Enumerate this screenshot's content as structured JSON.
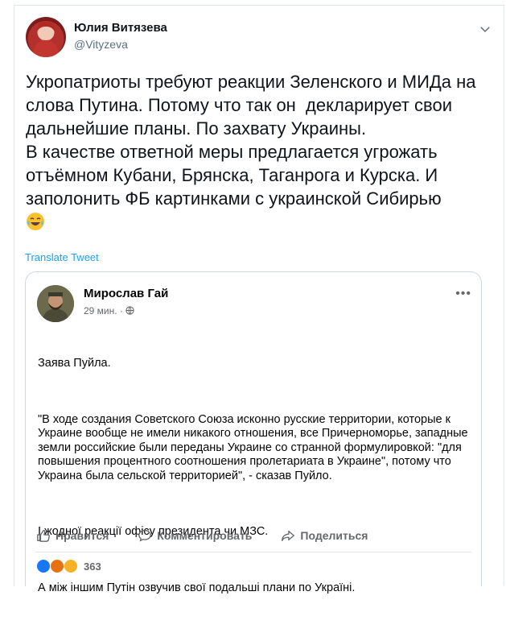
{
  "tweet": {
    "author_name": "Юлия Витязева",
    "author_handle": "@Vityzeva",
    "body": "Укропатриоты требуют реакции Зеленского и МИДа на слова Путина. Потому что так он  декларирует свои дальнейшие планы. По захвату Украины.\nВ качестве ответной меры предлагается угрожать отъёмном Кубани, Брянска, Таганрога и Курска. И заполонить ФБ картинками с украинской Сибирью",
    "translate_label": "Translate Tweet",
    "more_icon": "chevron-down-icon",
    "emoji": "😂"
  },
  "facebook_post": {
    "author_name": "Мирослав Гай",
    "time": "29 мин.",
    "paragraphs": [
      "Заява Пуйла.",
      "\"В ходе создания Советского Союза исконно русские территории, которые к Украине вообще не имели никакого отношения, все Причерноморье, западные земли российские были переданы Украине со странной формулировкой: \"для повышения процентного соотношения пролетариата в Украине\", потому что Украина была сельской территорией\", - сказав Пуйло.",
      "І жодної реакції офісу президента чи МЗС.",
      "А між іншим Путін озвучив свої подальші плани по Україні."
    ],
    "actions": {
      "like": "Нравится",
      "comment": "Комментировать",
      "share": "Поделиться"
    },
    "reaction_count": "363",
    "colors": {
      "like": "#1877f2",
      "angry": "#e9710f",
      "wow": "#f7b125"
    }
  }
}
